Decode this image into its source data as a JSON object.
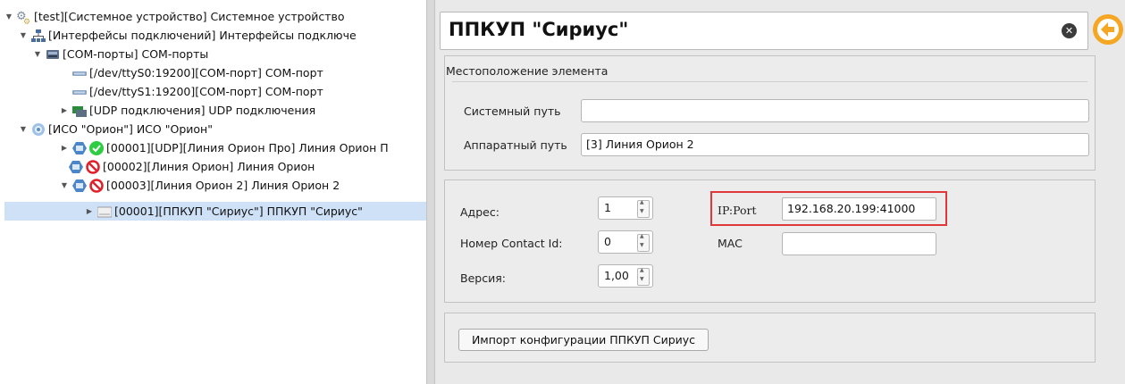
{
  "tree": {
    "items": [
      {
        "label": "[test][Системное устройство] Системное устройство",
        "icon": "gears-icon",
        "expanded": true
      },
      {
        "label": "[Интерфейсы подключений] Интерфейсы подключе",
        "icon": "network-icon",
        "expanded": true
      },
      {
        "label": "[COM-порты] COM-порты",
        "icon": "comports-icon",
        "expanded": true
      },
      {
        "label": "[/dev/ttyS0:19200][COM-порт] COM-порт",
        "icon": "port-icon"
      },
      {
        "label": "[/dev/ttyS1:19200][COM-порт] COM-порт",
        "icon": "port-icon"
      },
      {
        "label": "[UDP подключения] UDP подключения",
        "icon": "udp-icon",
        "expanded": false
      },
      {
        "label": "[ИСО \"Орион\"] ИСО \"Орион\"",
        "icon": "orion-icon",
        "expanded": true
      },
      {
        "label": "[00001][UDP][Линия Орион Про] Линия Орион П",
        "icon": "line-icon",
        "status": "ok-icon",
        "expanded": false
      },
      {
        "label": "[00002][Линия Орион] Линия Орион",
        "icon": "line-icon",
        "status": "disabled-icon"
      },
      {
        "label": "[00003][Линия Орион 2] Линия Орион 2",
        "icon": "line-icon",
        "status": "disabled-icon",
        "expanded": true
      },
      {
        "label": "[00001][ППКУП \"Сириус\"] ППКУП \"Сириус\"",
        "icon": "device-icon",
        "expanded": false,
        "selected": true
      }
    ]
  },
  "header": {
    "title": "ППКУП \"Сириус\"",
    "clear_glyph": "✕",
    "back_icon": "back-arrow-icon"
  },
  "location": {
    "group_title": "Местоположение элемента",
    "system_path_label": "Системный путь",
    "system_path_value": "",
    "hardware_path_label": "Аппаратный путь",
    "hardware_path_value": "[3] Линия Орион 2"
  },
  "params": {
    "address_label": "Адрес:",
    "address_value": "1",
    "contact_id_label": "Номер Contact Id:",
    "contact_id_value": "0",
    "version_label": "Версия:",
    "version_value": "1,00",
    "ipport_label": "IP:Port",
    "ipport_value": "192.168.20.199:41000",
    "mac_label": "MAC",
    "mac_value": ""
  },
  "actions": {
    "import_label": "Импорт конфигурации ППКУП Сириус"
  },
  "colors": {
    "selection": "#cfe1f7",
    "highlight_border": "#e0373b",
    "back_button": "#f5a623",
    "ok_status": "#2ecc40",
    "disabled_status": "#e0202a"
  }
}
